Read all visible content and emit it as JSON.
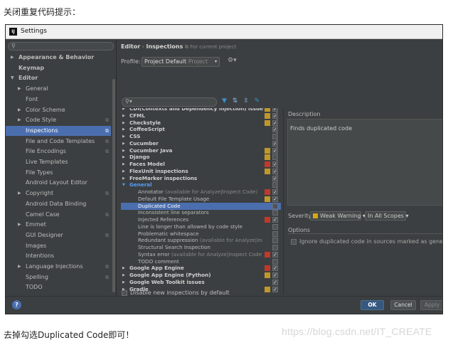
{
  "blog": {
    "top_text": "关闭重复代码提示：",
    "bottom_text": "去掉勾选Duplicated Code即可！",
    "watermark": "https://blog.csdn.net/IT_CREATE"
  },
  "window": {
    "title": "Settings",
    "app_icon_text": "IJ"
  },
  "sidebar": {
    "search_icon": "search-icon",
    "items": [
      {
        "label": "Appearance & Behavior",
        "arrow": "▶",
        "bold": true,
        "indent": 0,
        "proj": ""
      },
      {
        "label": "Keymap",
        "arrow": "",
        "bold": true,
        "indent": 0,
        "proj": ""
      },
      {
        "label": "Editor",
        "arrow": "▼",
        "bold": true,
        "indent": 0,
        "proj": ""
      },
      {
        "label": "General",
        "arrow": "▶",
        "bold": false,
        "indent": 1,
        "proj": ""
      },
      {
        "label": "Font",
        "arrow": "",
        "bold": false,
        "indent": 1,
        "proj": ""
      },
      {
        "label": "Color Scheme",
        "arrow": "▶",
        "bold": false,
        "indent": 1,
        "proj": ""
      },
      {
        "label": "Code Style",
        "arrow": "▶",
        "bold": false,
        "indent": 1,
        "proj": "⧉"
      },
      {
        "label": "Inspections",
        "arrow": "",
        "bold": false,
        "indent": 1,
        "proj": "⧉",
        "selected": true
      },
      {
        "label": "File and Code Templates",
        "arrow": "",
        "bold": false,
        "indent": 1,
        "proj": "⧉"
      },
      {
        "label": "File Encodings",
        "arrow": "",
        "bold": false,
        "indent": 1,
        "proj": "⧉"
      },
      {
        "label": "Live Templates",
        "arrow": "",
        "bold": false,
        "indent": 1,
        "proj": ""
      },
      {
        "label": "File Types",
        "arrow": "",
        "bold": false,
        "indent": 1,
        "proj": ""
      },
      {
        "label": "Android Layout Editor",
        "arrow": "",
        "bold": false,
        "indent": 1,
        "proj": ""
      },
      {
        "label": "Copyright",
        "arrow": "▶",
        "bold": false,
        "indent": 1,
        "proj": "⧉"
      },
      {
        "label": "Android Data Binding",
        "arrow": "",
        "bold": false,
        "indent": 1,
        "proj": ""
      },
      {
        "label": "Camel Case",
        "arrow": "",
        "bold": false,
        "indent": 1,
        "proj": "⧉"
      },
      {
        "label": "Emmet",
        "arrow": "▶",
        "bold": false,
        "indent": 1,
        "proj": ""
      },
      {
        "label": "GUI Designer",
        "arrow": "",
        "bold": false,
        "indent": 1,
        "proj": "⧉"
      },
      {
        "label": "Images",
        "arrow": "",
        "bold": false,
        "indent": 1,
        "proj": ""
      },
      {
        "label": "Intentions",
        "arrow": "",
        "bold": false,
        "indent": 1,
        "proj": ""
      },
      {
        "label": "Language Injections",
        "arrow": "▶",
        "bold": false,
        "indent": 1,
        "proj": "⧉"
      },
      {
        "label": "Spelling",
        "arrow": "",
        "bold": false,
        "indent": 1,
        "proj": "⧉"
      },
      {
        "label": "TODO",
        "arrow": "",
        "bold": false,
        "indent": 1,
        "proj": ""
      }
    ]
  },
  "header": {
    "crumb_editor": "Editor",
    "crumb_sep": "›",
    "crumb_page": "Inspections",
    "crumb_sub": "⧉ For current project",
    "profile_label": "Profile:",
    "profile_value": "Project Default",
    "profile_scope": "Project",
    "profile_dropdown": "▾",
    "gear": "⚙▾"
  },
  "toolbar": {
    "filter_icon": "▼",
    "expand_icon": "⇅",
    "collapse_icon": "⇳",
    "edit_icon": "✎",
    "colors": {
      "filter": "#3592c4",
      "expand": "#8ab4e8",
      "collapse": "#8ab4e8",
      "edit": "#3592c4"
    }
  },
  "inspections": {
    "rows": [
      {
        "label": "CDI(Contexts and Dependency Injection) issues",
        "kind": "group",
        "arrow": "▶",
        "sev": "#c0972b",
        "checked": true,
        "clipped": true
      },
      {
        "label": "CFML",
        "kind": "group",
        "arrow": "▶",
        "sev": "#c0972b",
        "checked": true
      },
      {
        "label": "Checkstyle",
        "kind": "group",
        "arrow": "▶",
        "sev": "#c0972b",
        "checked": true
      },
      {
        "label": "CoffeeScript",
        "kind": "group",
        "arrow": "▶",
        "sev": "",
        "checked": true
      },
      {
        "label": "CSS",
        "kind": "group",
        "arrow": "▶",
        "sev": "",
        "checked": false
      },
      {
        "label": "Cucumber",
        "kind": "group",
        "arrow": "▶",
        "sev": "",
        "checked": true
      },
      {
        "label": "Cucumber Java",
        "kind": "group",
        "arrow": "▶",
        "sev": "#c0972b",
        "checked": true
      },
      {
        "label": "Django",
        "kind": "group",
        "arrow": "▶",
        "sev": "#c0972b",
        "checked": false
      },
      {
        "label": "Faces Model",
        "kind": "group",
        "arrow": "▶",
        "sev": "#c0392b",
        "checked": true
      },
      {
        "label": "FlexUnit inspections",
        "kind": "group",
        "arrow": "▶",
        "sev": "#c0972b",
        "checked": true
      },
      {
        "label": "FreeMarker inspections",
        "kind": "group",
        "arrow": "▶",
        "sev": "",
        "checked": true
      },
      {
        "label": "General",
        "kind": "blue",
        "arrow": "▼",
        "sev": "",
        "checked": false
      },
      {
        "label": "Annotator",
        "note": " (available for Analyze|Inspect Code)",
        "kind": "item",
        "sev": "#c0392b",
        "checked": true
      },
      {
        "label": "Default File Template Usage",
        "kind": "item",
        "sev": "#c0972b",
        "checked": true
      },
      {
        "label": "Duplicated Code",
        "kind": "item",
        "sev": "",
        "checked": false,
        "selected": true
      },
      {
        "label": "Inconsistent line separators",
        "kind": "item",
        "sev": "",
        "checked": false
      },
      {
        "label": "Injected References",
        "kind": "item",
        "sev": "#c0392b",
        "checked": true
      },
      {
        "label": "Line is longer than allowed by code style",
        "kind": "item",
        "sev": "",
        "checked": false
      },
      {
        "label": "Problematic whitespace",
        "kind": "item",
        "sev": "",
        "checked": false
      },
      {
        "label": "Redundant suppression",
        "note": " (available for Analyze|Inspe",
        "kind": "item",
        "sev": "",
        "checked": false
      },
      {
        "label": "Structural Search Inspection",
        "kind": "item",
        "sev": "",
        "checked": false
      },
      {
        "label": "Syntax error",
        "note": " (available for Analyze|Inspect Code)",
        "kind": "item",
        "sev": "#c0392b",
        "checked": true
      },
      {
        "label": "TODO comment",
        "kind": "item",
        "sev": "",
        "checked": false
      },
      {
        "label": "Google App Engine",
        "kind": "group",
        "arrow": "▶",
        "sev": "#c0392b",
        "checked": true
      },
      {
        "label": "Google App Engine (Python)",
        "kind": "group",
        "arrow": "▶",
        "sev": "#c0972b",
        "checked": true
      },
      {
        "label": "Google Web Toolkit issues",
        "kind": "group",
        "arrow": "▶",
        "sev": "",
        "checked": true
      },
      {
        "label": "Gradle",
        "kind": "group",
        "arrow": "▶",
        "sev": "#c0972b",
        "checked": true
      }
    ],
    "disable_new_label": "Disable new inspections by default"
  },
  "details": {
    "description_label": "Description",
    "description_text": "Finds duplicated code",
    "severity_label": "Severity:",
    "severity_value": "Weak Warning",
    "severity_color": "#d7a70e",
    "scope_value": "In All Scopes",
    "dropdown_arrow": "▾",
    "options_label": "Options",
    "option_text": "Ignore duplicated code in sources marked as generated"
  },
  "buttons": {
    "help": "?",
    "ok": "OK",
    "cancel": "Cancel",
    "apply": "Apply"
  }
}
